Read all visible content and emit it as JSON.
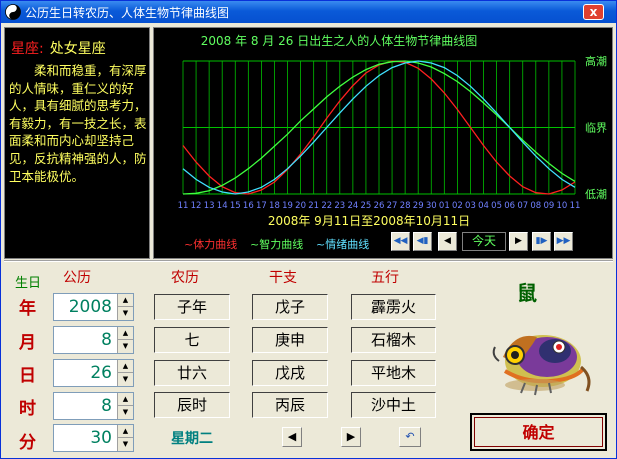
{
  "window": {
    "title": "公历生日转农历、人体生物节律曲线图",
    "close_label": "x"
  },
  "description": {
    "star_label": "星座:",
    "star_value": "处女星座",
    "text": "柔和而稳重，有深厚的人情味，重仁义的好人，具有细腻的思考力，有毅力，有一技之长，表面柔和而内心却坚持己见，反抗精神强的人，防卫本能极优。"
  },
  "biorhythm": {
    "title": "2008 年  8 月 26 日出生之人的人体生物节律曲线图",
    "level_labels": [
      "高潮",
      "临界",
      "低潮"
    ],
    "date_range": "2008年  9月11日至2008年10月11日",
    "legend": {
      "physical": "~体力曲线",
      "intellectual": "~智力曲线",
      "emotional": "~情绪曲线"
    },
    "today_label": "今天",
    "colors": {
      "physical": "#ff2020",
      "intellectual": "#40ff40",
      "emotional": "#40e0ff",
      "grid": "#00c000",
      "ticks": "#7080ff"
    }
  },
  "chart_data": {
    "type": "line",
    "x": [
      "11",
      "12",
      "13",
      "14",
      "15",
      "16",
      "17",
      "18",
      "19",
      "20",
      "21",
      "22",
      "23",
      "24",
      "25",
      "26",
      "27",
      "28",
      "29",
      "30",
      "01",
      "02",
      "03",
      "04",
      "05",
      "06",
      "07",
      "08",
      "09",
      "10",
      "11"
    ],
    "series": [
      {
        "name": "体力曲线",
        "values": [
          -0.27,
          -0.52,
          -0.73,
          -0.89,
          -0.98,
          -1.0,
          -0.94,
          -0.82,
          -0.63,
          -0.4,
          -0.14,
          0.14,
          0.4,
          0.63,
          0.82,
          0.94,
          1.0,
          0.98,
          0.89,
          0.73,
          0.52,
          0.27,
          0.0,
          -0.27,
          -0.52,
          -0.73,
          -0.89,
          -0.98,
          -1.0,
          -0.94,
          -0.82
        ]
      },
      {
        "name": "智力曲线",
        "values": [
          -1.0,
          -0.99,
          -0.95,
          -0.87,
          -0.76,
          -0.62,
          -0.46,
          -0.28,
          -0.1,
          0.1,
          0.28,
          0.46,
          0.62,
          0.76,
          0.87,
          0.95,
          0.99,
          1.0,
          0.97,
          0.91,
          0.81,
          0.69,
          0.54,
          0.37,
          0.19,
          0.0,
          -0.19,
          -0.37,
          -0.54,
          -0.69,
          -0.81
        ]
      },
      {
        "name": "情绪曲线",
        "values": [
          -0.62,
          -0.78,
          -0.9,
          -0.97,
          -1.0,
          -0.97,
          -0.9,
          -0.78,
          -0.62,
          -0.43,
          -0.22,
          0.0,
          0.22,
          0.43,
          0.62,
          0.78,
          0.9,
          0.97,
          1.0,
          0.97,
          0.9,
          0.78,
          0.62,
          0.43,
          0.22,
          0.0,
          -0.22,
          -0.43,
          -0.62,
          -0.78,
          -0.9
        ]
      }
    ],
    "ylim": [
      -1,
      1
    ]
  },
  "converter": {
    "headers": {
      "birth": "生日",
      "solar": "公历",
      "lunar": "农历",
      "ganzhi": "干支",
      "wuxing": "五行"
    },
    "rows": [
      {
        "label": "年",
        "value": "2008",
        "lunar": "子年",
        "ganzhi": "戊子",
        "wuxing": "霹雳火"
      },
      {
        "label": "月",
        "value": "8",
        "lunar": "七",
        "ganzhi": "庚申",
        "wuxing": "石榴木"
      },
      {
        "label": "日",
        "value": "26",
        "lunar": "廿六",
        "ganzhi": "戊戌",
        "wuxing": "平地木"
      },
      {
        "label": "时",
        "value": "8",
        "lunar": "辰时",
        "ganzhi": "丙辰",
        "wuxing": "沙中土"
      },
      {
        "label": "分",
        "value": "30"
      }
    ],
    "weekday": "星期二"
  },
  "zodiac": {
    "animal": "鼠"
  },
  "ok_label": "确定"
}
